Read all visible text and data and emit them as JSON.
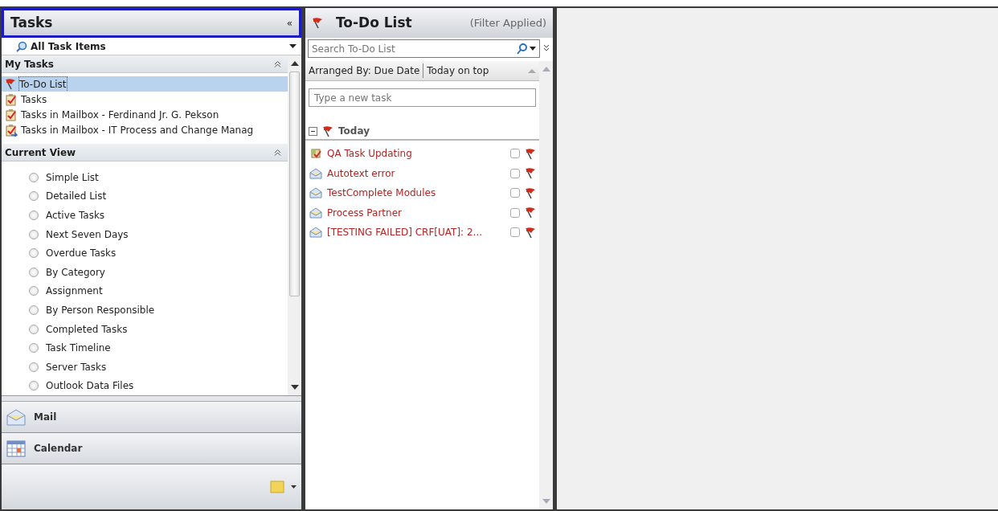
{
  "nav_pane": {
    "title": "Tasks",
    "collapse_glyph": "«",
    "focused": true,
    "view_selector": {
      "value": "All Task Items"
    },
    "my_tasks": {
      "title": "My Tasks",
      "expanded": true,
      "items": [
        {
          "label": "To-Do List",
          "kind": "todo",
          "selected": true
        },
        {
          "label": "Tasks",
          "kind": "tasks",
          "selected": false
        },
        {
          "label": "Tasks in Mailbox - Ferdinand Jr. G. Pekson",
          "kind": "tasks",
          "selected": false
        },
        {
          "label": "Tasks in Mailbox - IT Process and Change Manag",
          "kind": "shared",
          "selected": false
        }
      ]
    },
    "current_view": {
      "title": "Current View",
      "expanded": true,
      "items": [
        {
          "label": "Simple List",
          "checked": false
        },
        {
          "label": "Detailed List",
          "checked": false
        },
        {
          "label": "Active Tasks",
          "checked": false
        },
        {
          "label": "Next Seven Days",
          "checked": false
        },
        {
          "label": "Overdue Tasks",
          "checked": false
        },
        {
          "label": "By Category",
          "checked": false
        },
        {
          "label": "Assignment",
          "checked": false
        },
        {
          "label": "By Person Responsible",
          "checked": false
        },
        {
          "label": "Completed Tasks",
          "checked": false
        },
        {
          "label": "Task Timeline",
          "checked": false
        },
        {
          "label": "Server Tasks",
          "checked": false
        },
        {
          "label": "Outlook Data Files",
          "checked": false
        }
      ]
    },
    "buttons": [
      {
        "label": "Mail",
        "kind": "mail"
      },
      {
        "label": "Calendar",
        "kind": "calendar"
      }
    ]
  },
  "todo": {
    "title": "To-Do List",
    "filter_note": "(Filter Applied)",
    "search": {
      "placeholder": "Search To-Do List"
    },
    "arranged_by": "Arranged By: Due Date",
    "sort_order": "Today on top",
    "new_task": {
      "placeholder": "Type a new task"
    },
    "group": {
      "label": "Today",
      "expanded": true
    },
    "items": [
      {
        "subject": "QA Task Updating",
        "kind": "task",
        "complete": false
      },
      {
        "subject": "Autotext error",
        "kind": "mail",
        "complete": false
      },
      {
        "subject": "TestComplete Modules",
        "kind": "mail",
        "complete": false
      },
      {
        "subject": "Process Partner",
        "kind": "mail",
        "complete": false
      },
      {
        "subject": "[TESTING FAILED] CRF[UAT]: 2...",
        "kind": "mail",
        "complete": false
      }
    ]
  }
}
